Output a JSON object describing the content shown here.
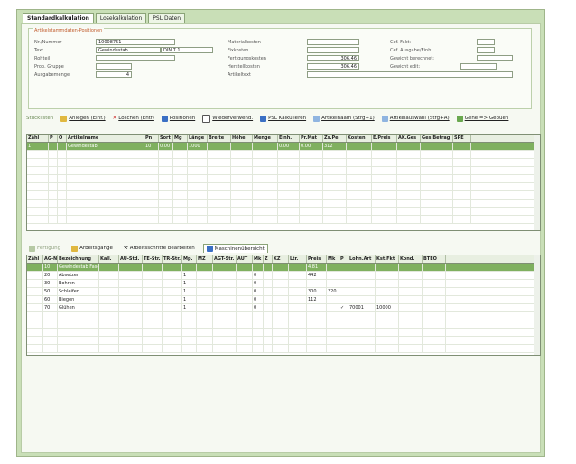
{
  "tabs": [
    "Standardkalkulation",
    "Losekalkulation",
    "PSL Daten"
  ],
  "header": {
    "group_title": "Artikelstammdaten-Positionen",
    "left": [
      {
        "label": "Nr./Nummer",
        "value": "10008751"
      },
      {
        "label": "Text",
        "value": "Gewindestab",
        "value2": "DIN 7.1"
      },
      {
        "label": "Rohteil",
        "value": ""
      },
      {
        "label": "Prop. Gruppe",
        "value": ""
      },
      {
        "label": "Ausgabemenge",
        "value": "4"
      }
    ],
    "middle": [
      {
        "label": "Materialkosten",
        "value": ""
      },
      {
        "label": "Fixkosten",
        "value": ""
      },
      {
        "label": "Fertigungskosten",
        "value": "306.46"
      },
      {
        "label": "Herstellkosten",
        "value": "306.46"
      },
      {
        "label": "Artikeltext",
        "value": ""
      }
    ],
    "right": [
      {
        "label": "Cef. Fakt:",
        "value": ""
      },
      {
        "label": "Cef. Ausgabe/Einh:",
        "value": ""
      },
      {
        "label": "Gewicht berechnet:",
        "value": ""
      },
      {
        "label": "Gewicht edit:",
        "value": ""
      }
    ]
  },
  "toolbar1": {
    "first": "Stücklisten",
    "buttons": [
      {
        "label": "Anlegen (Einf.)",
        "icon": "add-icon"
      },
      {
        "label": "Löschen (Entf)",
        "icon": "delete-icon"
      },
      {
        "label": "Positionen",
        "icon": "positions-icon"
      },
      {
        "label": "Wiederverwend.",
        "icon": "reuse-icon"
      },
      {
        "label": "PSL Kalkulieren",
        "icon": "calc-icon"
      },
      {
        "label": "Artikelnaam (Strg+1)",
        "icon": "article-icon"
      },
      {
        "label": "Artikelauswahl (Strg+A)",
        "icon": "select-icon"
      },
      {
        "label": "Gehe => Gebuen",
        "icon": "goto-icon"
      }
    ]
  },
  "grid1": {
    "columns": [
      "Zähl",
      "P",
      "O",
      "Artikelname",
      "Pn",
      "Sort",
      "Mg",
      "Länge",
      "Breite",
      "Höhe",
      "Menge",
      "Einh.",
      "Pr.Mat",
      "Zs.Pe",
      "Kosten",
      "E.Preis",
      "AK.Ges",
      "Ges.Betrag",
      "SPE"
    ],
    "rows": [
      {
        "cells": [
          "1",
          "",
          "",
          "Gewindestab",
          "10",
          "0.00",
          "",
          "1000",
          "",
          "",
          "",
          "0.00",
          "0.00",
          "312",
          "",
          "",
          "",
          "",
          ""
        ],
        "selected": true
      }
    ]
  },
  "toolbar2": {
    "tabs": [
      {
        "label": "Fertigung",
        "icon": "folder-icon"
      },
      {
        "label": "Arbeitsgänge",
        "icon": "work-icon"
      },
      {
        "label": "Arbeitsschritte bearbeiten",
        "icon": "wrench-icon"
      },
      {
        "label": "Maschinenübersicht",
        "icon": "machine-icon",
        "active": true
      }
    ]
  },
  "grid2": {
    "columns": [
      "Zähl",
      "AG-Nr",
      "Bezeichnung",
      "Kall.",
      "AU-Std.",
      "TE-Str.",
      "TR-Str.",
      "Mp.",
      "MZ",
      "AGT-Str.",
      "AUT",
      "Mk",
      "Z",
      "KZ",
      "Ltr.",
      "Preis",
      "Mk",
      "P",
      "Lohn.Art",
      "Kst.Fkt",
      "Kond.",
      "BTEO"
    ],
    "rows": [
      {
        "cells": [
          "",
          "10",
          "Gewindestab Fasen",
          "",
          "",
          "",
          "",
          "",
          "",
          "",
          "",
          "",
          "",
          "",
          "",
          "4.81",
          "",
          "",
          "",
          "",
          "",
          ""
        ],
        "selected": true
      },
      {
        "cells": [
          "",
          "20",
          "Absetzen",
          "",
          "",
          "",
          "",
          "1",
          "",
          "",
          "",
          "0",
          "",
          "",
          "",
          "442",
          "",
          "",
          "",
          "",
          "",
          ""
        ]
      },
      {
        "cells": [
          "",
          "30",
          "Bohren",
          "",
          "",
          "",
          "",
          "1",
          "",
          "",
          "",
          "0",
          "",
          "",
          "",
          "",
          "",
          "",
          "",
          "",
          "",
          ""
        ]
      },
      {
        "cells": [
          "",
          "50",
          "Schleifen",
          "",
          "",
          "",
          "",
          "1",
          "",
          "",
          "",
          "0",
          "",
          "",
          "",
          "300",
          "320",
          "",
          "",
          "",
          "",
          ""
        ]
      },
      {
        "cells": [
          "",
          "60",
          "Biegen",
          "",
          "",
          "",
          "",
          "1",
          "",
          "",
          "",
          "0",
          "",
          "",
          "",
          "112",
          "",
          "",
          "",
          "",
          "",
          ""
        ]
      },
      {
        "cells": [
          "",
          "70",
          "Glühen",
          "",
          "",
          "",
          "",
          "1",
          "",
          "",
          "",
          "0",
          "",
          "",
          "",
          "",
          "",
          "✓",
          "70001",
          "10000",
          "",
          ""
        ]
      }
    ]
  }
}
